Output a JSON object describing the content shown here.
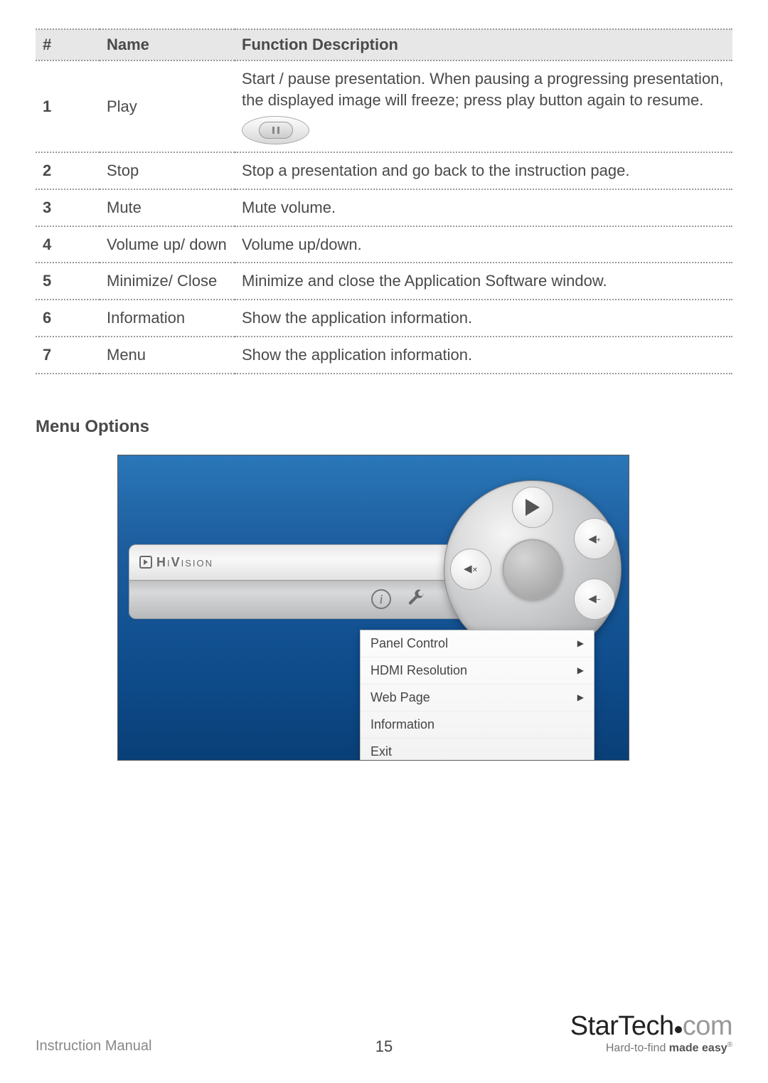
{
  "table": {
    "headers": {
      "num": "#",
      "name": "Name",
      "desc": "Function Description"
    },
    "rows": [
      {
        "num": "1",
        "name": "Play",
        "desc": "Start / pause presentation. When pausing a progressing presentation, the displayed image will freeze; press play button again to resume.",
        "hasPause": true
      },
      {
        "num": "2",
        "name": "Stop",
        "desc": "Stop a presentation and go back to the instruction page."
      },
      {
        "num": "3",
        "name": "Mute",
        "desc": "Mute volume."
      },
      {
        "num": "4",
        "name": "Volume up/ down",
        "desc": "Volume up/down."
      },
      {
        "num": "5",
        "name": "Minimize/ Close",
        "desc": "Minimize and close the Application Software window."
      },
      {
        "num": "6",
        "name": "Information",
        "desc": "Show the application information."
      },
      {
        "num": "7",
        "name": "Menu",
        "desc": "Show the application information."
      }
    ]
  },
  "section_heading": "Menu Options",
  "panel": {
    "brand_prefix": "H",
    "brand_suffix": "V",
    "brand_small": "ISION",
    "brand_small_pre": "I",
    "minimize": "—",
    "close": "✕",
    "info": "i"
  },
  "menu": {
    "items": [
      {
        "label": "Panel Control",
        "arrow": true
      },
      {
        "label": "HDMI Resolution",
        "arrow": true
      },
      {
        "label": "Web Page",
        "arrow": true
      },
      {
        "label": "Information",
        "arrow": false
      },
      {
        "label": "Exit",
        "arrow": false
      }
    ]
  },
  "footer": {
    "left": "Instruction Manual",
    "page": "15",
    "brand": "StarTech",
    "brand_suffix": "com",
    "tagline_plain": "Hard-to-find ",
    "tagline_bold": "made easy",
    "reg": "®"
  }
}
